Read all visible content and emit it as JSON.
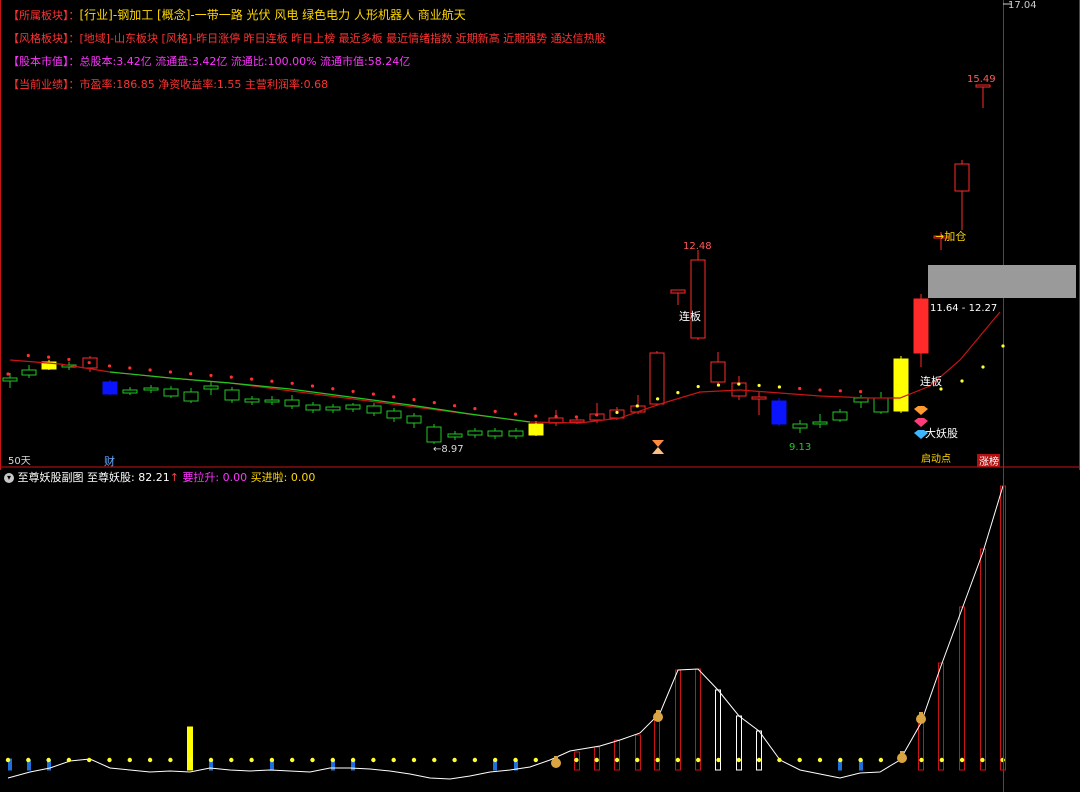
{
  "info": {
    "sector": {
      "label": "【所属板块】：",
      "value": "[行业]-钢加工 [概念]-一带一路 光伏 风电 绿色电力 人形机器人 商业航天"
    },
    "style": {
      "label": "【风格板块】：",
      "value": "[地域]-山东板块 [风格]-昨日涨停 昨日连板 昨日上榜 最近多板 最近情绪指数 近期新高 近期强势 通达信热股"
    },
    "equity": {
      "label": "【股本市值】：",
      "value": "总股本:3.42亿 流通盘:3.42亿 流通比:100.00% 流通市值:58.24亿"
    },
    "performance": {
      "label": "【当前业绩】：",
      "value": "市盈率:186.85 净资收益率:1.55 主营利润率:0.68"
    }
  },
  "main_chart": {
    "top_price_label": "17.04",
    "period_label": "50天",
    "finance_marker": "财",
    "low_marker_1": "←8.97",
    "low_marker_2": "9.13",
    "high_marker_1": "12.48",
    "high_marker_2": "15.49",
    "range_box_label": "11.64 - 12.27",
    "add_position_label": "→加仓",
    "limit_up_label_1": "连板",
    "limit_up_label_2": "连板",
    "demon_label": "大妖股",
    "start_label": "启动点",
    "rank_badge": "涨榜",
    "colors": {
      "up": "#ff2a2a",
      "down": "#22c922",
      "ma": "#c81414",
      "ma_green": "#22c922",
      "highlight_yellow": "#ffff00",
      "highlight_blue": "#0a14ff",
      "dot_yellow": "#ffff33",
      "box_gray": "#9a9a9a"
    }
  },
  "sub_chart": {
    "title_icon": "chevron-down-icon",
    "title": "至尊妖股副图",
    "indicator_name": "至尊妖股:",
    "indicator_value": "82.21",
    "up_arrow": "↑",
    "rally_label": "要拉升:",
    "rally_value": "0.00",
    "buy_label": "买进啦:",
    "buy_value": "0.00",
    "colors": {
      "bar_red": "#c81414",
      "bar_white": "#ffffff",
      "bar_blue": "#1e6fd9",
      "bar_yellow": "#ffff00",
      "line": "#ffffff",
      "dot": "#ffff33"
    }
  }
}
